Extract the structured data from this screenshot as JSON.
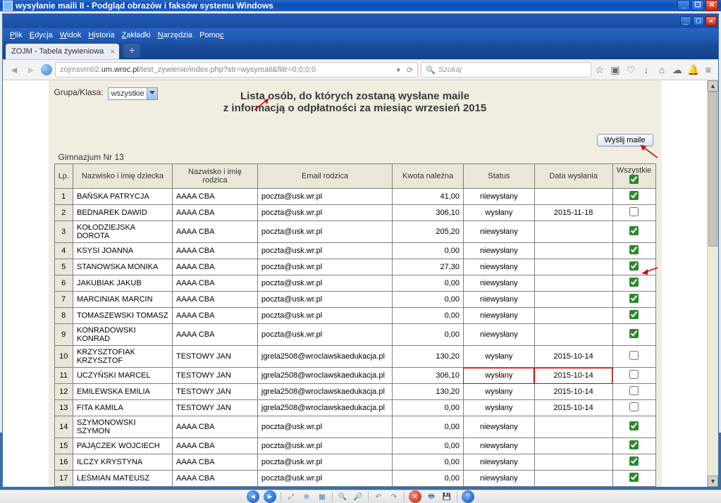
{
  "window": {
    "title": "wysyłanie maili II - Podgląd obrazów i faksów systemu Windows"
  },
  "browser": {
    "menu": {
      "file": "Plik",
      "edit": "Edycja",
      "view": "Widok",
      "history": "Historia",
      "bookmarks": "Zakładki",
      "tools": "Narzędzia",
      "help": "Pomoc"
    },
    "tab_title": "ZOJM - Tabela żywieniowa",
    "url_pre": "zojmsvm02.",
    "url_mid": "um.wroc.pl",
    "url_post": "/test_zywienie/index.php?str=wysymail&filtr=0;0;0;0",
    "search_placeholder": "Szukaj"
  },
  "page": {
    "group_label": "Grupa/Klasa:",
    "group_value": "wszystkie",
    "title_line1": "Lista osób, do których zostaną wysłane maile",
    "title_line2": "z informacją o odpłatności za miesiąc wrzesień 2015",
    "send_button": "Wyślij maile",
    "school": "Gimnazjum Nr 13",
    "headers": {
      "lp": "Lp.",
      "child": "Nazwisko i imię dziecka",
      "parent": "Nazwisko i imię rodzica",
      "email": "Email rodzica",
      "amount": "Kwota należna",
      "status": "Status",
      "date": "Data wysłania",
      "all": "Wszystkie"
    },
    "rows": [
      {
        "lp": "1",
        "child": "BAŃSKA PATRYCJA",
        "parent": "AAAA CBA",
        "email": "poczta@usk.wr.pl",
        "amount": "41,00",
        "status": "niewysłany",
        "date": "",
        "chk": true
      },
      {
        "lp": "2",
        "child": "BEDNAREK DAWID",
        "parent": "AAAA CBA",
        "email": "poczta@usk.wr.pl",
        "amount": "306,10",
        "status": "wysłany",
        "date": "2015-11-18",
        "chk": false
      },
      {
        "lp": "3",
        "child": "KOŁODZIEJSKA DOROTA",
        "parent": "AAAA CBA",
        "email": "poczta@usk.wr.pl",
        "amount": "205,20",
        "status": "niewysłany",
        "date": "",
        "chk": true
      },
      {
        "lp": "4",
        "child": "KSYSI JOANNA",
        "parent": "AAAA CBA",
        "email": "poczta@usk.wr.pl",
        "amount": "0,00",
        "status": "niewysłany",
        "date": "",
        "chk": true
      },
      {
        "lp": "5",
        "child": "STANOWSKA MONIKA",
        "parent": "AAAA CBA",
        "email": "poczta@usk.wr.pl",
        "amount": "27,30",
        "status": "niewysłany",
        "date": "",
        "chk": true
      },
      {
        "lp": "6",
        "child": "JAKUBIAK JAKUB",
        "parent": "AAAA CBA",
        "email": "poczta@usk.wr.pl",
        "amount": "0,00",
        "status": "niewysłany",
        "date": "",
        "chk": true
      },
      {
        "lp": "7",
        "child": "MARCINIAK MARCIN",
        "parent": "AAAA CBA",
        "email": "poczta@usk.wr.pl",
        "amount": "0,00",
        "status": "niewysłany",
        "date": "",
        "chk": true
      },
      {
        "lp": "8",
        "child": "TOMASZEWSKI TOMASZ",
        "parent": "AAAA CBA",
        "email": "poczta@usk.wr.pl",
        "amount": "0,00",
        "status": "niewysłany",
        "date": "",
        "chk": true
      },
      {
        "lp": "9",
        "child": "KONRADOWSKI KONRAD",
        "parent": "AAAA CBA",
        "email": "poczta@usk.wr.pl",
        "amount": "0,00",
        "status": "niewysłany",
        "date": "",
        "chk": true
      },
      {
        "lp": "10",
        "child": "KRZYSZTOFIAK KRZYSZTOF",
        "parent": "TESTOWY JAN",
        "email": "jgrela2508@wroclawskaedukacja.pl",
        "amount": "130,20",
        "status": "wysłany",
        "date": "2015-10-14",
        "chk": false
      },
      {
        "lp": "11",
        "child": "UCZYŃSKI MARCEL",
        "parent": "TESTOWY JAN",
        "email": "jgrela2508@wroclawskaedukacja.pl",
        "amount": "306,10",
        "status": "wysłany",
        "date": "2015-10-14",
        "chk": false,
        "highlight": true
      },
      {
        "lp": "12",
        "child": "EMILEWSKA EMILIA",
        "parent": "TESTOWY JAN",
        "email": "jgrela2508@wroclawskaedukacja.pl",
        "amount": "130,20",
        "status": "wysłany",
        "date": "2015-10-14",
        "chk": false
      },
      {
        "lp": "13",
        "child": "FITA KAMILA",
        "parent": "TESTOWY JAN",
        "email": "jgrela2508@wroclawskaedukacja.pl",
        "amount": "0,00",
        "status": "wysłany",
        "date": "2015-10-14",
        "chk": false
      },
      {
        "lp": "14",
        "child": "SZYMONOWSKI SZYMON",
        "parent": "AAAA CBA",
        "email": "poczta@usk.wr.pl",
        "amount": "0,00",
        "status": "niewysłany",
        "date": "",
        "chk": true
      },
      {
        "lp": "15",
        "child": "PAJĄCZEK WOJCIECH",
        "parent": "AAAA CBA",
        "email": "poczta@usk.wr.pl",
        "amount": "0,00",
        "status": "niewysłany",
        "date": "",
        "chk": true
      },
      {
        "lp": "16",
        "child": "ILCZY KRYSTYNA",
        "parent": "AAAA CBA",
        "email": "poczta@usk.wr.pl",
        "amount": "0,00",
        "status": "niewysłany",
        "date": "",
        "chk": true
      },
      {
        "lp": "17",
        "child": "LEŚMIAN MATEUSZ",
        "parent": "AAAA CBA",
        "email": "poczta@usk.wr.pl",
        "amount": "0,00",
        "status": "niewysłany",
        "date": "",
        "chk": true
      }
    ]
  }
}
